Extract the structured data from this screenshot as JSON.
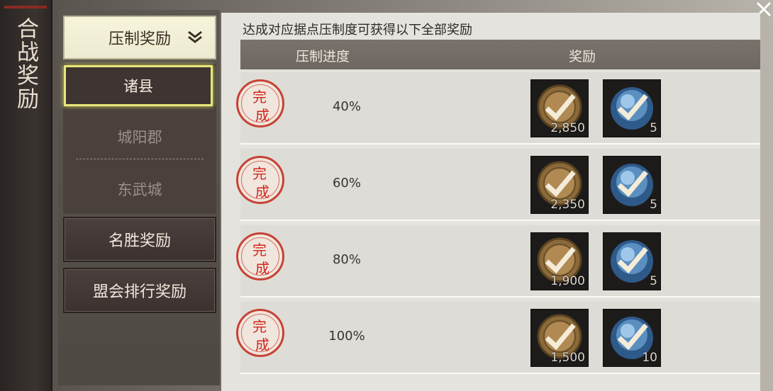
{
  "title": "合战奖励",
  "nav": {
    "dropdown_label": "压制奖励",
    "sub_items": [
      {
        "label": "诸县",
        "active": true
      },
      {
        "label": "城阳郡",
        "active": false
      },
      {
        "label": "东武城",
        "active": false
      }
    ],
    "buttons": [
      "名胜奖励",
      "盟会排行奖励"
    ]
  },
  "panel": {
    "header": "达成对应据点压制度可获得以下全部奖励",
    "col_progress": "压制进度",
    "col_reward": "奖励",
    "rows": [
      {
        "status": "完成",
        "progress": "40%",
        "coin_qty": "2,850",
        "gem_qty": "5"
      },
      {
        "status": "完成",
        "progress": "60%",
        "coin_qty": "2,350",
        "gem_qty": "5"
      },
      {
        "status": "完成",
        "progress": "80%",
        "coin_qty": "1,900",
        "gem_qty": "5"
      },
      {
        "status": "完成",
        "progress": "100%",
        "coin_qty": "1,500",
        "gem_qty": "10"
      }
    ]
  },
  "icons": {
    "coin": "coin-reward-icon",
    "gem": "blue-orb-reward-icon",
    "check": "checkmark-icon",
    "close": "close-icon",
    "chevron": "double-chevron-down-icon"
  },
  "colors": {
    "accent_highlight": "#e8e77a",
    "stamp_red": "#d2261c"
  }
}
